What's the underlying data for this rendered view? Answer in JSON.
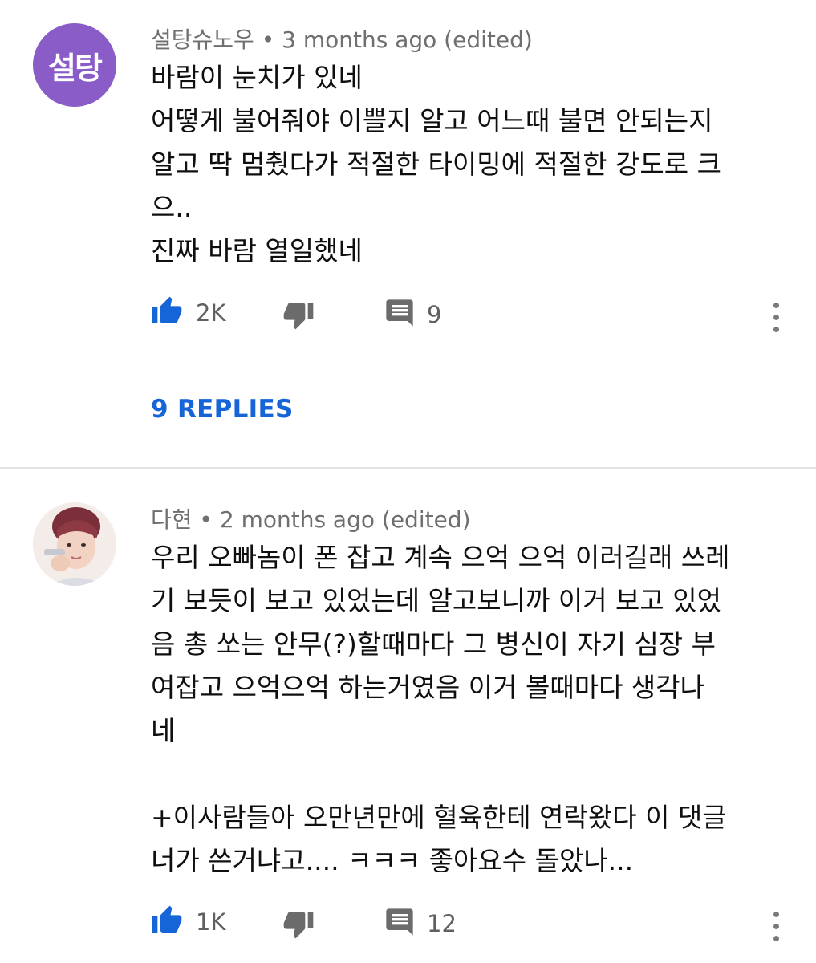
{
  "comments": [
    {
      "avatar_text": "설탕",
      "avatar_color": "#8a5cc7",
      "author": "설탕슈노우",
      "time": " • 3 months ago (edited)",
      "text": "바람이 눈치가 있네\n어떻게 불어줘야 이쁠지 알고 어느때 불면 안되는지\n알고 딱 멈췄다가 적절한 타이밍에 적절한 강도로 크\n으..\n진짜 바람 열일했네",
      "likes": "2K",
      "reply_count": "9",
      "replies_link": "9 REPLIES"
    },
    {
      "avatar_description": "profile photo",
      "author": "다현",
      "time": " • 2 months ago (edited)",
      "text": "우리 오빠놈이 폰 잡고 계속 으억 으억 이러길래 쓰레\n기 보듯이 보고 있었는데 알고보니까 이거 보고 있었\n음 총 쏘는 안무(?)할때마다 그 병신이 자기 심장 부\n여잡고 으억으억 하는거였음 이거 볼때마다 생각나\n네\n\n+이사람들아 오만년만에 혈육한테 연락왔다 이 댓글\n너가 쓴거냐고.... ㅋㅋㅋ 좋아요수 돌았나...",
      "likes": "1K",
      "reply_count": "12"
    }
  ],
  "colors": {
    "icon": "#1565d8",
    "muted_icon": "#6b6b6b",
    "link": "#1565d8"
  },
  "icons": [
    "thumbs-up-icon",
    "thumbs-down-icon",
    "comment-icon",
    "more-vert-icon"
  ]
}
